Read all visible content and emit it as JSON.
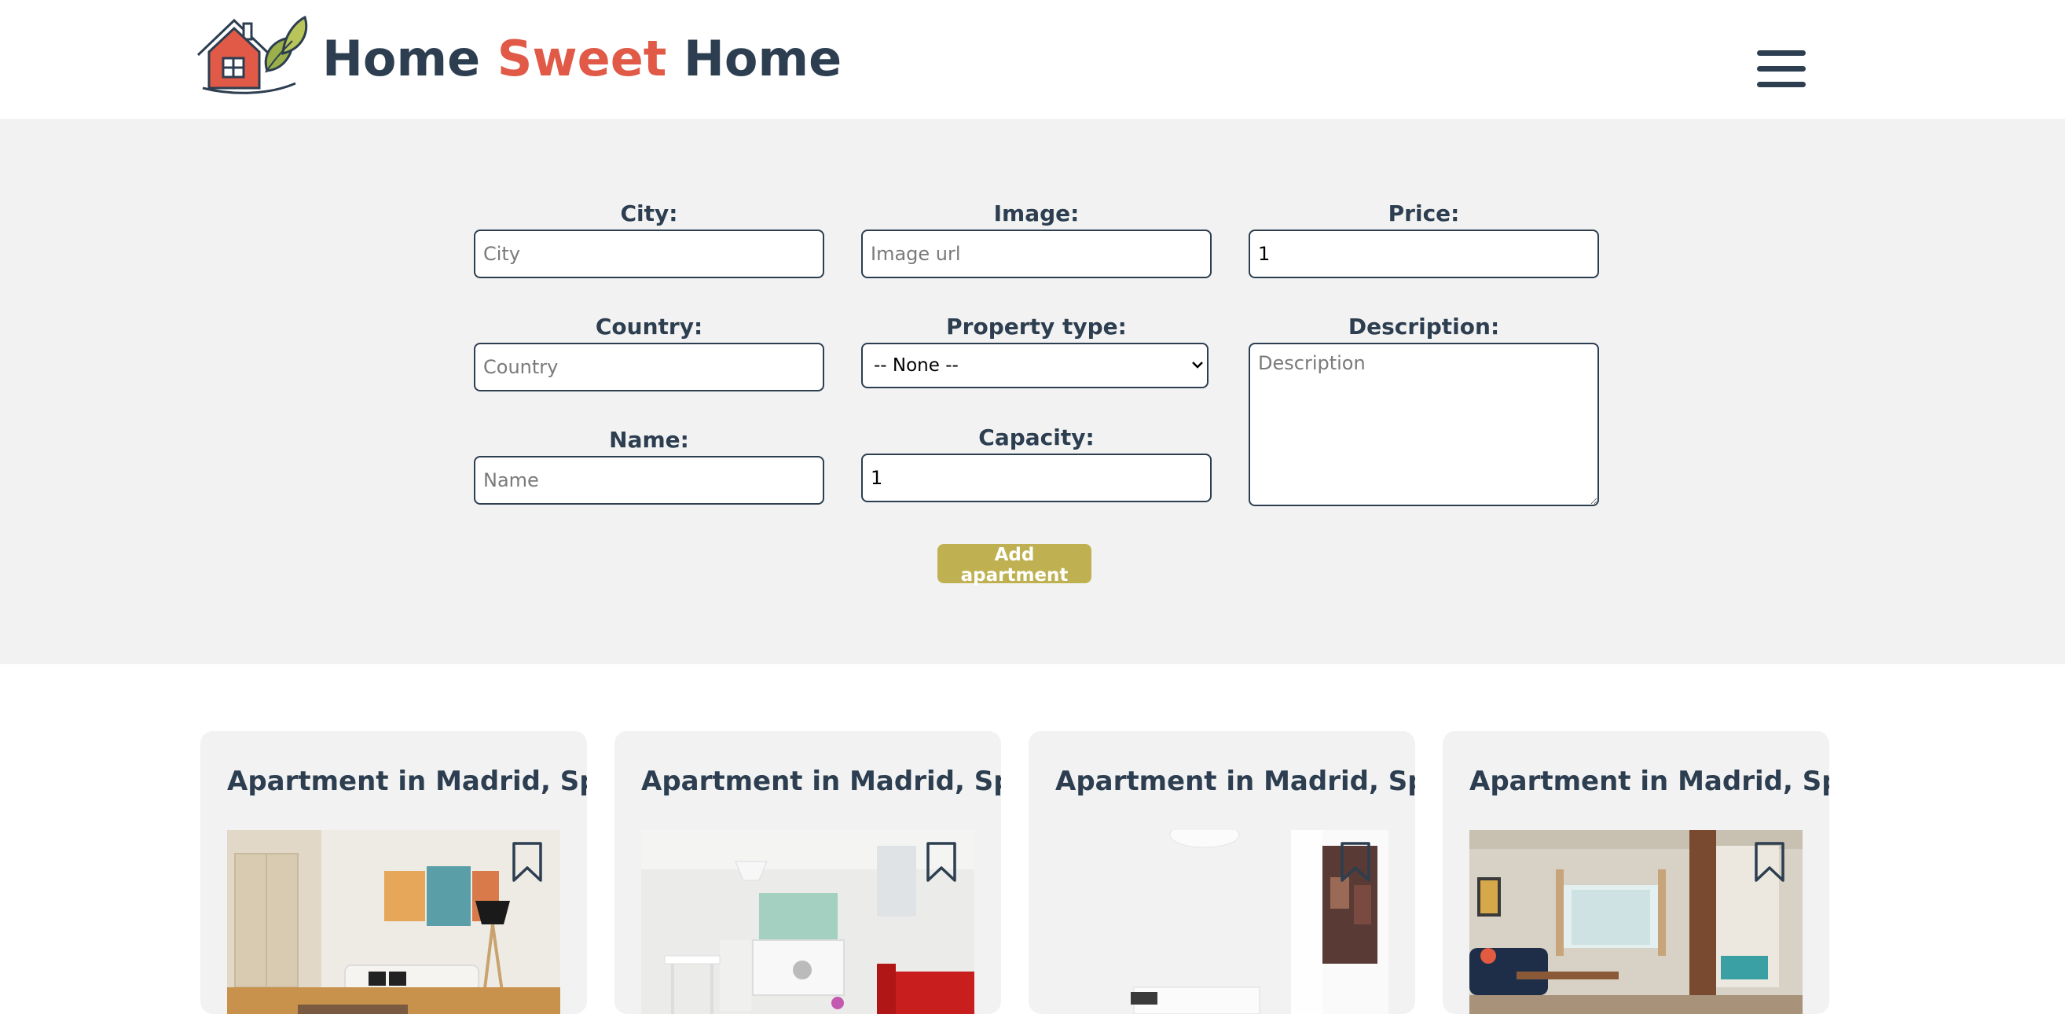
{
  "header": {
    "brand": {
      "word1": "Home",
      "word2": "Sweet",
      "word3": "Home"
    },
    "logo_icon": "house-with-leaves-logo",
    "menu_icon": "hamburger-menu-icon"
  },
  "form": {
    "city": {
      "label": "City:",
      "placeholder": "City",
      "value": ""
    },
    "image": {
      "label": "Image:",
      "placeholder": "Image url",
      "value": ""
    },
    "price": {
      "label": "Price:",
      "placeholder": "",
      "value": "1"
    },
    "country": {
      "label": "Country:",
      "placeholder": "Country",
      "value": ""
    },
    "property_type": {
      "label": "Property type:",
      "selected": "-- None --"
    },
    "description": {
      "label": "Description:",
      "placeholder": "Description",
      "value": ""
    },
    "name": {
      "label": "Name:",
      "placeholder": "Name",
      "value": ""
    },
    "capacity": {
      "label": "Capacity:",
      "value": "1"
    },
    "submit_label": "Add apartment"
  },
  "colors": {
    "primary": "#2c3e50",
    "accent": "#e05a47",
    "button": "#bfb152",
    "section_bg": "#f2f2f2"
  },
  "apartments": [
    {
      "title": "Apartment in Madrid, Spain",
      "bookmark_icon": "bookmark-icon"
    },
    {
      "title": "Apartment in Madrid, Spain",
      "bookmark_icon": "bookmark-icon"
    },
    {
      "title": "Apartment in Madrid, Spain",
      "bookmark_icon": "bookmark-icon"
    },
    {
      "title": "Apartment in Madrid, Spain",
      "bookmark_icon": "bookmark-icon"
    }
  ]
}
